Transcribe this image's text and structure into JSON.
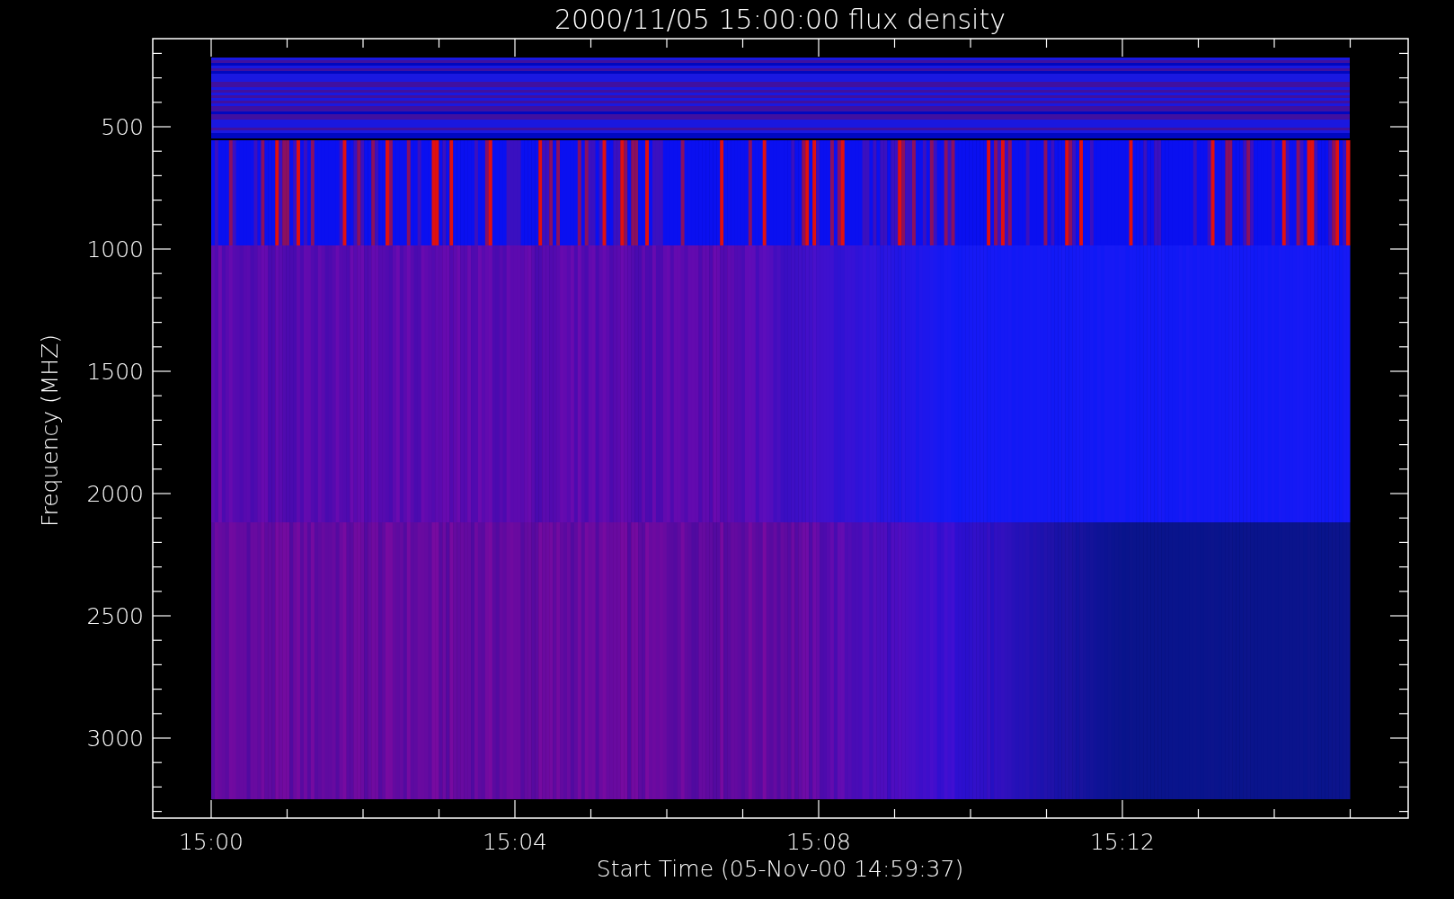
{
  "plot": {
    "title": "2000/11/05 15:00:00 flux density",
    "xlabel": "Start Time (05-Nov-00 14:59:37)",
    "ylabel": "Frequency (MHZ)",
    "xtick_labels": [
      "15:00",
      "15:04",
      "15:08",
      "15:12"
    ],
    "ytick_labels": [
      "500",
      "1000",
      "1500",
      "2000",
      "2500",
      "3000"
    ]
  }
}
